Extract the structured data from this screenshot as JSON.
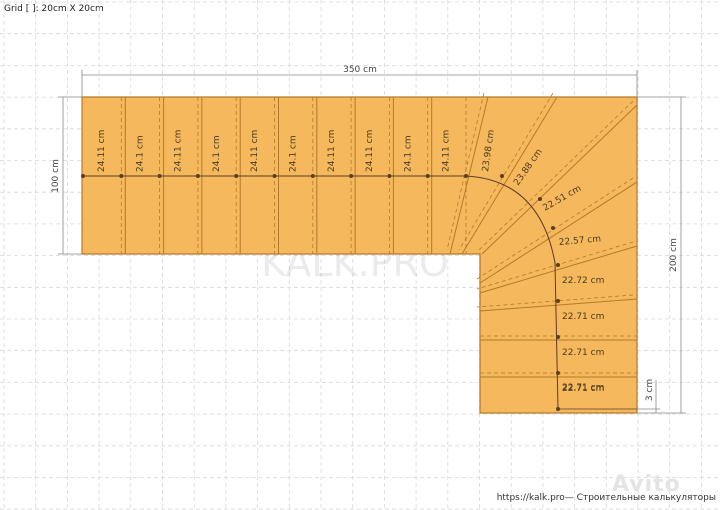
{
  "grid_caption": "Grid [ ]: 20cm X 20cm",
  "footer": "https://kalk.pro— Строительные калькуляторы",
  "watermark": "KALK.PRO",
  "avito_watermark": "Avito",
  "dimensions": {
    "width": "350 cm",
    "flight_width": "100 cm",
    "depth": "200 cm",
    "offset": "3 cm"
  },
  "upper_treads": [
    "24.11 cm",
    "24.1 cm",
    "24.11 cm",
    "24.1 cm",
    "24.11 cm",
    "24.1 cm",
    "24.11 cm",
    "24.11 cm",
    "24.1 cm",
    "24.11 cm"
  ],
  "winder_treads": [
    "23.98 cm",
    "23.88 cm",
    "22.51 cm",
    "22.57 cm",
    "22.72 cm"
  ],
  "lower_treads": [
    "22.71 cm",
    "22.71 cm",
    "22.71 cm"
  ],
  "colors": {
    "tread_fill": "#f6b85c",
    "tread_line": "#b37a2a",
    "walkline": "#5a3e25",
    "grid": "#d8d8d8"
  }
}
